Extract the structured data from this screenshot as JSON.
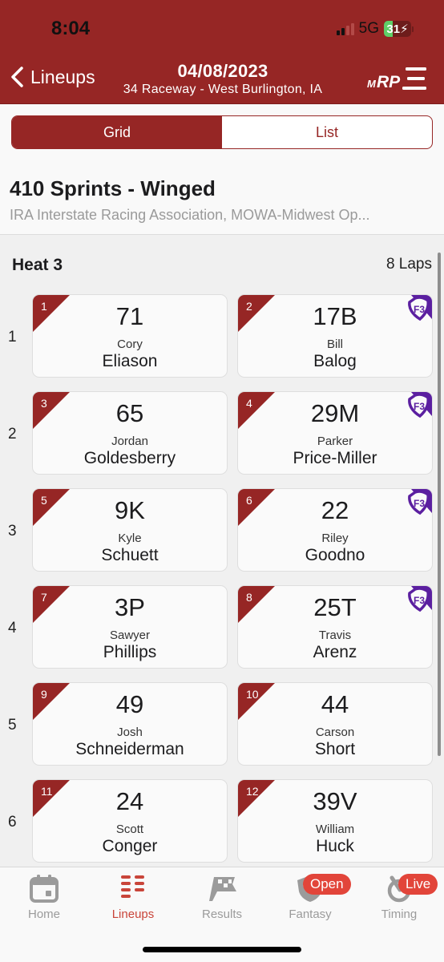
{
  "status_bar": {
    "time": "8:04",
    "network": "5G",
    "battery_percent": 31,
    "battery_label": "31",
    "charging": true
  },
  "header": {
    "back_label": "Lineups",
    "date": "04/08/2023",
    "venue": "34 Raceway - West Burlington, IA",
    "logo_text": "MRP"
  },
  "view_toggle": {
    "options": [
      "Grid",
      "List"
    ],
    "selected": "Grid"
  },
  "event_class": {
    "title": "410 Sprints - Winged",
    "sanctions": "IRA Interstate Racing Association, MOWA-Midwest Op..."
  },
  "heat": {
    "title": "Heat 3",
    "laps": "8 Laps",
    "rows": [
      {
        "row": "1",
        "cars": [
          {
            "pos": "1",
            "car": "71",
            "first": "Cory",
            "last": "Eliason",
            "badge": false
          },
          {
            "pos": "2",
            "car": "17B",
            "first": "Bill",
            "last": "Balog",
            "badge": true
          }
        ]
      },
      {
        "row": "2",
        "cars": [
          {
            "pos": "3",
            "car": "65",
            "first": "Jordan",
            "last": "Goldesberry",
            "badge": false
          },
          {
            "pos": "4",
            "car": "29M",
            "first": "Parker",
            "last": "Price-Miller",
            "badge": true
          }
        ]
      },
      {
        "row": "3",
        "cars": [
          {
            "pos": "5",
            "car": "9K",
            "first": "Kyle",
            "last": "Schuett",
            "badge": false
          },
          {
            "pos": "6",
            "car": "22",
            "first": "Riley",
            "last": "Goodno",
            "badge": true
          }
        ]
      },
      {
        "row": "4",
        "cars": [
          {
            "pos": "7",
            "car": "3P",
            "first": "Sawyer",
            "last": "Phillips",
            "badge": false
          },
          {
            "pos": "8",
            "car": "25T",
            "first": "Travis",
            "last": "Arenz",
            "badge": true
          }
        ]
      },
      {
        "row": "5",
        "cars": [
          {
            "pos": "9",
            "car": "49",
            "first": "Josh",
            "last": "Schneiderman",
            "badge": false
          },
          {
            "pos": "10",
            "car": "44",
            "first": "Carson",
            "last": "Short",
            "badge": false
          }
        ]
      },
      {
        "row": "6",
        "cars": [
          {
            "pos": "11",
            "car": "24",
            "first": "Scott",
            "last": "Conger",
            "badge": false
          },
          {
            "pos": "12",
            "car": "39V",
            "first": "William",
            "last": "Huck",
            "badge": false
          }
        ]
      }
    ]
  },
  "tab_bar": {
    "tabs": [
      {
        "label": "Home",
        "icon": "calendar-icon",
        "active": false
      },
      {
        "label": "Lineups",
        "icon": "grid-list-icon",
        "active": true
      },
      {
        "label": "Results",
        "icon": "checkered-flag-icon",
        "active": false
      },
      {
        "label": "Fantasy",
        "icon": "shield-icon",
        "active": false,
        "badge": "Open"
      },
      {
        "label": "Timing",
        "icon": "stopwatch-icon",
        "active": false,
        "badge": "Live"
      }
    ]
  },
  "colors": {
    "brand": "#962625",
    "badge_purple": "#5b1fa0",
    "tab_active": "#c9453a",
    "tab_badge": "#e2453a"
  }
}
